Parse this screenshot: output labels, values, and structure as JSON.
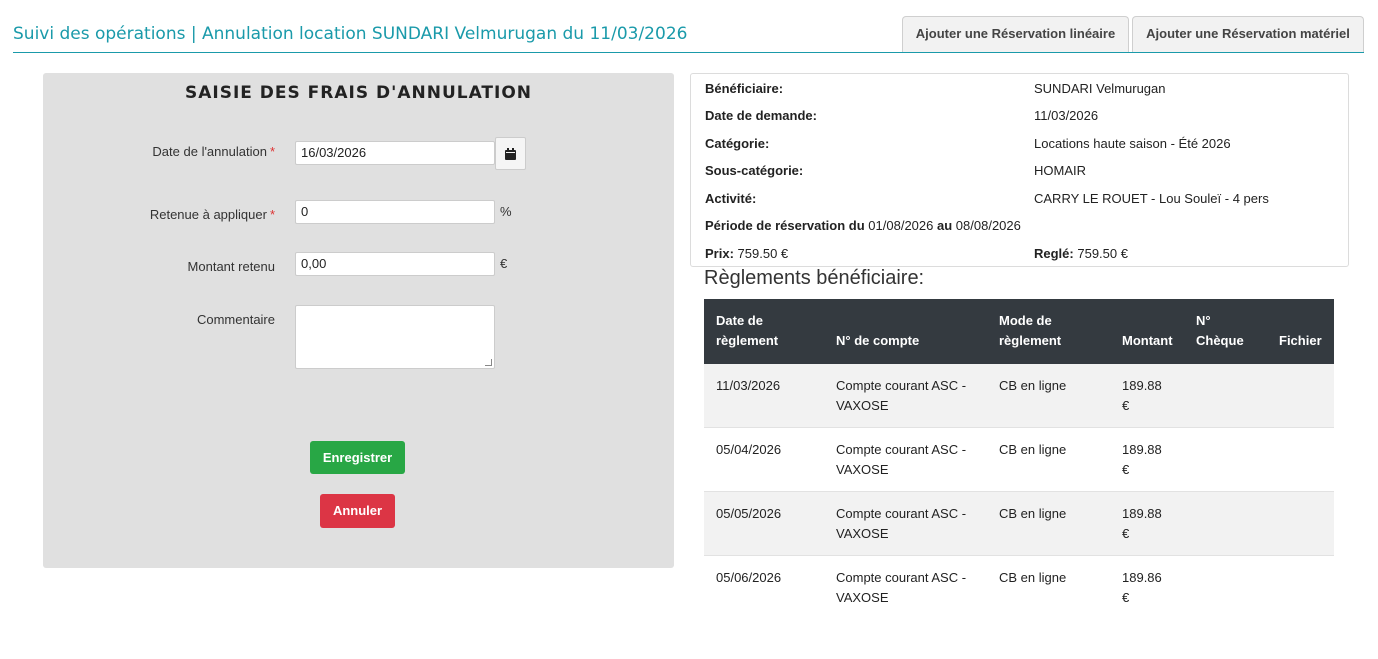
{
  "header": {
    "title": "Suivi des opérations | Annulation location SUNDARI Velmurugan du 11/03/2026",
    "tab_lineaire": "Ajouter une Réservation linéaire",
    "tab_materiel": "Ajouter une Réservation matériel"
  },
  "form": {
    "title": "SAISIE DES FRAIS D'ANNULATION",
    "date_label": "Date de l'annulation",
    "date_value": "16/03/2026",
    "retenue_label": "Retenue à appliquer",
    "retenue_value": "0",
    "retenue_unit": "%",
    "montant_label": "Montant retenu",
    "montant_value": "0,00",
    "montant_unit": "€",
    "comment_label": "Commentaire",
    "required_mark": "*",
    "save_label": "Enregistrer",
    "cancel_label": "Annuler"
  },
  "info": {
    "beneficiaire_label": "Bénéficiaire:",
    "beneficiaire_value": "SUNDARI Velmurugan",
    "date_demande_label": "Date de demande:",
    "date_demande_value": "11/03/2026",
    "categorie_label": "Catégorie:",
    "categorie_value": "Locations haute saison - Été 2026",
    "sous_categorie_label": "Sous-catégorie:",
    "sous_categorie_value": "HOMAIR",
    "activite_label": "Activité:",
    "activite_value": "CARRY LE ROUET - Lou Souleï - 4 pers",
    "periode_label": "Période de réservation du",
    "periode_start": "01/08/2026",
    "periode_mid": "au",
    "periode_end": "08/08/2026",
    "prix_label": "Prix:",
    "prix_value": "759.50 €",
    "regle_label": "Reglé:",
    "regle_value": "759.50 €"
  },
  "payments": {
    "title": "Règlements bénéficiaire:",
    "headers": {
      "date_1": "Date de",
      "date_2": "règlement",
      "compte": "N° de compte",
      "mode_1": "Mode de",
      "mode_2": "règlement",
      "montant": "Montant",
      "cheque_1": "N°",
      "cheque_2": "Chèque",
      "fichier": "Fichier"
    },
    "rows": [
      {
        "date": "11/03/2026",
        "compte_1": "Compte courant ASC -",
        "compte_2": "VAXOSE",
        "mode": "CB en ligne",
        "montant_1": "189.88",
        "montant_2": "€"
      },
      {
        "date": "05/04/2026",
        "compte_1": "Compte courant ASC -",
        "compte_2": "VAXOSE",
        "mode": "CB en ligne",
        "montant_1": "189.88",
        "montant_2": "€"
      },
      {
        "date": "05/05/2026",
        "compte_1": "Compte courant ASC -",
        "compte_2": "VAXOSE",
        "mode": "CB en ligne",
        "montant_1": "189.88",
        "montant_2": "€"
      },
      {
        "date": "05/06/2026",
        "compte_1": "Compte courant ASC -",
        "compte_2": "VAXOSE",
        "mode": "CB en ligne",
        "montant_1": "189.86",
        "montant_2": "€"
      }
    ]
  }
}
